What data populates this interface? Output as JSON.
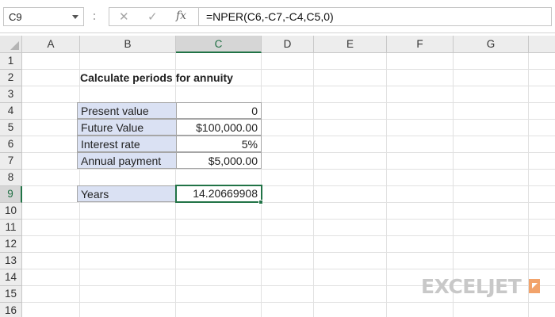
{
  "formula_bar": {
    "name_box": "C9",
    "cancel_icon": "✕",
    "enter_icon": "✓",
    "fx_label": "fx",
    "formula": "=NPER(C6,-C7,-C4,C5,0)"
  },
  "columns": [
    "A",
    "B",
    "C",
    "D",
    "E",
    "F",
    "G"
  ],
  "selected_column": "C",
  "rows": [
    "1",
    "2",
    "3",
    "4",
    "5",
    "6",
    "7",
    "8",
    "9",
    "10",
    "11",
    "12",
    "13",
    "14",
    "15",
    "16"
  ],
  "selected_row": "9",
  "sheet": {
    "title": "Calculate periods for annuity",
    "table": [
      {
        "label": "Present value",
        "value": "0"
      },
      {
        "label": "Future Value",
        "value": "$100,000.00"
      },
      {
        "label": "Interest rate",
        "value": "5%"
      },
      {
        "label": "Annual payment",
        "value": "$5,000.00"
      }
    ],
    "result": {
      "label": "Years",
      "value": "14.20669908"
    }
  },
  "logo": {
    "text": "EXCELJET"
  },
  "colors": {
    "accent": "#217346",
    "label_fill": "#dae1f3",
    "logo": "#c8c8c8",
    "logo_mark": "#f2a36b"
  }
}
